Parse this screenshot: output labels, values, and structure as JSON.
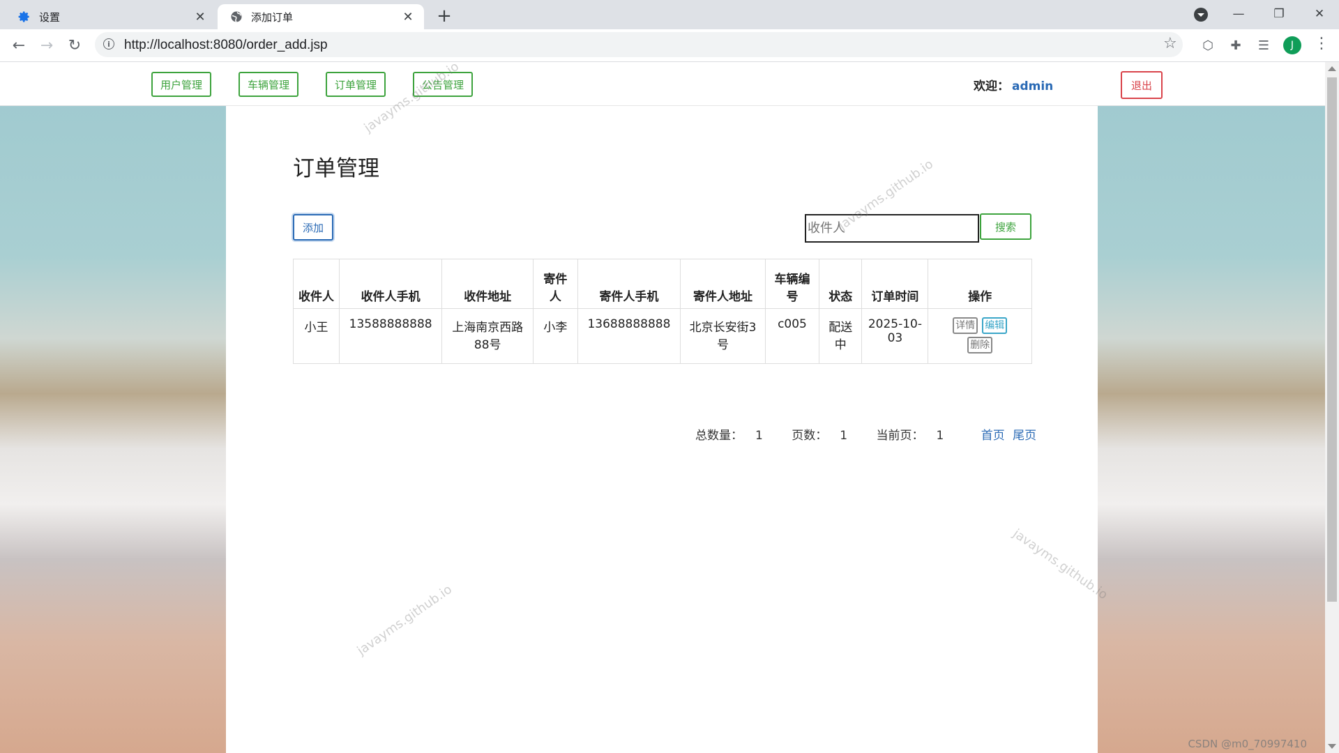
{
  "browser": {
    "tabs": [
      {
        "label": "设置",
        "icon": "gear-icon",
        "active": false
      },
      {
        "label": "添加订单",
        "icon": "globe-icon",
        "active": true
      }
    ],
    "url": "http://localhost:8080/order_add.jsp",
    "profile_initial": "J"
  },
  "nav": {
    "items": [
      "用户管理",
      "车辆管理",
      "订单管理",
      "公告管理"
    ],
    "welcome_label": "欢迎：",
    "username": "admin",
    "logout_label": "退出"
  },
  "main": {
    "title": "订单管理",
    "add_label": "添加",
    "search_placeholder": "收件人",
    "search_label": "搜索"
  },
  "table": {
    "headers": [
      "收件人",
      "收件人手机",
      "收件地址",
      "寄件人",
      "寄件人手机",
      "寄件人地址",
      "车辆编号",
      "状态",
      "订单时间",
      "操作"
    ],
    "rows": [
      {
        "receiver": "小王",
        "receiver_phone": "13588888888",
        "receiver_address": "上海南京西路88号",
        "sender": "小李",
        "sender_phone": "13688888888",
        "sender_address": "北京长安街3号",
        "vehicle_no": "c005",
        "status": "配送中",
        "order_time": "2025-10-03",
        "ops": {
          "detail": "详情",
          "edit": "编辑",
          "delete": "删除"
        }
      }
    ]
  },
  "pager": {
    "total_label": "总数量：",
    "total": "1",
    "pages_label": "页数：",
    "pages": "1",
    "current_label": "当前页：",
    "current": "1",
    "first": "首页",
    "last": "尾页"
  },
  "watermark": "javayms.github.io",
  "credit": "CSDN @m0_70997410"
}
